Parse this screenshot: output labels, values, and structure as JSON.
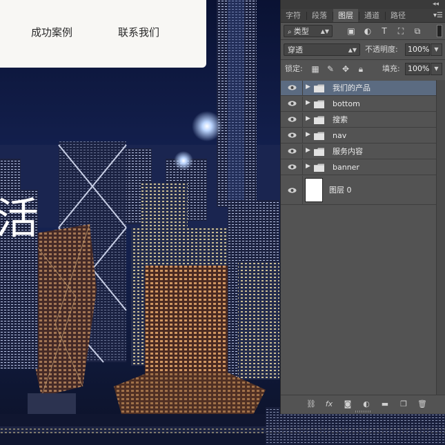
{
  "website": {
    "nav_links": [
      "成功案例",
      "联系我们"
    ],
    "hero_text": "活"
  },
  "photoshop": {
    "tabs": [
      "字符",
      "段落",
      "图层",
      "通道",
      "路径"
    ],
    "active_tab": "图层",
    "filter": {
      "label": "类型",
      "icon": "search-icon"
    },
    "blend_mode": "穿透",
    "opacity_label": "不透明度:",
    "opacity_value": "100%",
    "lock_label": "锁定:",
    "fill_label": "填充:",
    "fill_value": "100%",
    "layers": [
      {
        "name": "我们的产品",
        "type": "group",
        "selected": true
      },
      {
        "name": "bottom",
        "type": "group",
        "selected": false
      },
      {
        "name": "搜索",
        "type": "group",
        "selected": false
      },
      {
        "name": "nav",
        "type": "group",
        "selected": false
      },
      {
        "name": "服务内容",
        "type": "group",
        "selected": false
      },
      {
        "name": "banner",
        "type": "group",
        "selected": false
      },
      {
        "name": "图层 0",
        "type": "layer",
        "selected": false
      }
    ],
    "colors": {
      "panel_bg": "#535353",
      "selected_row": "#5b6b81",
      "tab_bar": "#3e3e3e"
    }
  }
}
